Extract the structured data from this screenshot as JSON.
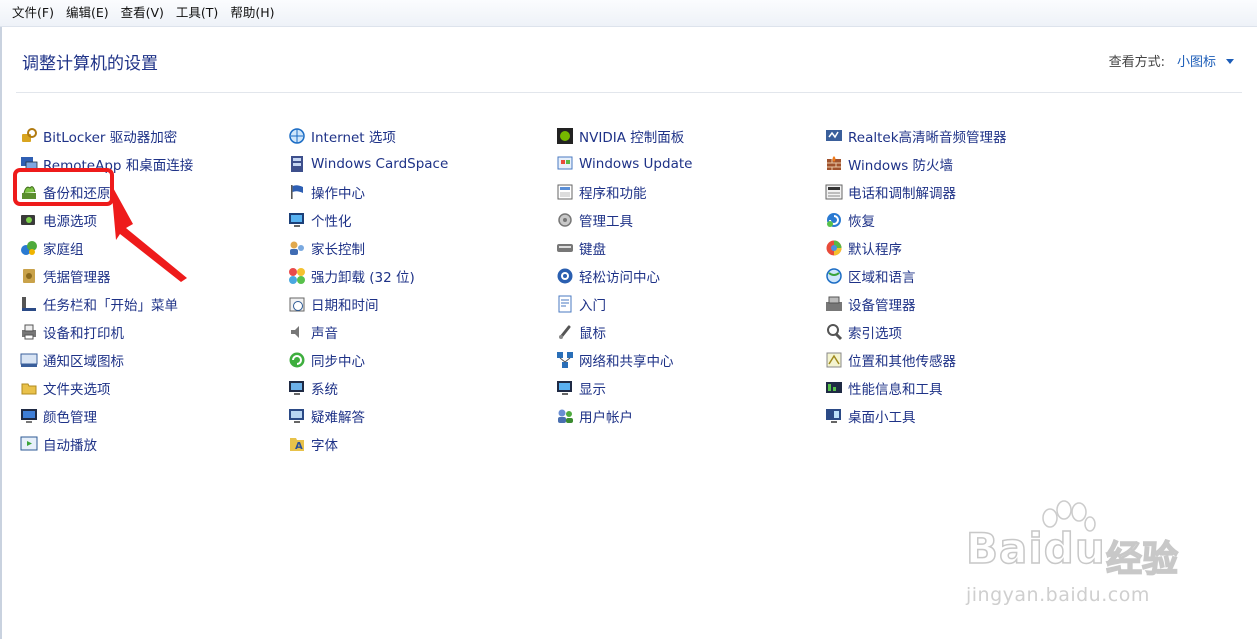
{
  "menu": [
    "文件(F)",
    "编辑(E)",
    "查看(V)",
    "工具(T)",
    "帮助(H)"
  ],
  "header": {
    "title": "调整计算机的设置",
    "view_label": "查看方式:",
    "view_value": "小图标"
  },
  "columns": [
    [
      {
        "label": "BitLocker 驱动器加密",
        "icon": "bitlocker-key-icon"
      },
      {
        "label": "RemoteApp 和桌面连接",
        "icon": "remoteapp-icon"
      },
      {
        "label": "备份和还原",
        "icon": "backup-restore-icon"
      },
      {
        "label": "电源选项",
        "icon": "power-options-icon"
      },
      {
        "label": "家庭组",
        "icon": "homegroup-icon"
      },
      {
        "label": "凭据管理器",
        "icon": "credential-manager-icon"
      },
      {
        "label": "任务栏和「开始」菜单",
        "icon": "taskbar-icon"
      },
      {
        "label": "设备和打印机",
        "icon": "printer-icon"
      },
      {
        "label": "通知区域图标",
        "icon": "notification-icon"
      },
      {
        "label": "文件夹选项",
        "icon": "folder-options-icon"
      },
      {
        "label": "颜色管理",
        "icon": "color-management-icon"
      },
      {
        "label": "自动播放",
        "icon": "autoplay-icon"
      }
    ],
    [
      {
        "label": "Internet 选项",
        "icon": "internet-options-icon"
      },
      {
        "label": "Windows CardSpace",
        "icon": "cardspace-icon"
      },
      {
        "label": "操作中心",
        "icon": "action-center-flag-icon"
      },
      {
        "label": "个性化",
        "icon": "personalization-icon"
      },
      {
        "label": "家长控制",
        "icon": "parental-controls-icon"
      },
      {
        "label": "强力卸载 (32 位)",
        "icon": "uninstaller-icon"
      },
      {
        "label": "日期和时间",
        "icon": "date-time-icon"
      },
      {
        "label": "声音",
        "icon": "sound-icon"
      },
      {
        "label": "同步中心",
        "icon": "sync-center-icon"
      },
      {
        "label": "系统",
        "icon": "system-icon"
      },
      {
        "label": "疑难解答",
        "icon": "troubleshooting-icon"
      },
      {
        "label": "字体",
        "icon": "fonts-icon"
      }
    ],
    [
      {
        "label": "NVIDIA 控制面板",
        "icon": "nvidia-icon"
      },
      {
        "label": "Windows Update",
        "icon": "windows-update-icon"
      },
      {
        "label": "程序和功能",
        "icon": "programs-features-icon"
      },
      {
        "label": "管理工具",
        "icon": "admin-tools-icon"
      },
      {
        "label": "键盘",
        "icon": "keyboard-icon"
      },
      {
        "label": "轻松访问中心",
        "icon": "ease-of-access-icon"
      },
      {
        "label": "入门",
        "icon": "getting-started-icon"
      },
      {
        "label": "鼠标",
        "icon": "mouse-icon"
      },
      {
        "label": "网络和共享中心",
        "icon": "network-icon"
      },
      {
        "label": "显示",
        "icon": "display-icon"
      },
      {
        "label": "用户帐户",
        "icon": "user-accounts-icon"
      }
    ],
    [
      {
        "label": "Realtek高清晰音频管理器",
        "icon": "realtek-audio-icon"
      },
      {
        "label": "Windows 防火墙",
        "icon": "firewall-icon"
      },
      {
        "label": "电话和调制解调器",
        "icon": "phone-modem-icon"
      },
      {
        "label": "恢复",
        "icon": "recovery-icon"
      },
      {
        "label": "默认程序",
        "icon": "default-programs-icon"
      },
      {
        "label": "区域和语言",
        "icon": "region-language-icon"
      },
      {
        "label": "设备管理器",
        "icon": "device-manager-icon"
      },
      {
        "label": "索引选项",
        "icon": "indexing-options-icon"
      },
      {
        "label": "位置和其他传感器",
        "icon": "location-sensors-icon"
      },
      {
        "label": "性能信息和工具",
        "icon": "performance-icon"
      },
      {
        "label": "桌面小工具",
        "icon": "gadgets-icon"
      }
    ]
  ],
  "watermark": {
    "logo": "Baidu",
    "cn": "经验",
    "url": "jingyan.baidu.com"
  },
  "colors": {
    "link": "#1e3287",
    "accent": "#1c5db8",
    "annotation": "#ee1b1b"
  }
}
